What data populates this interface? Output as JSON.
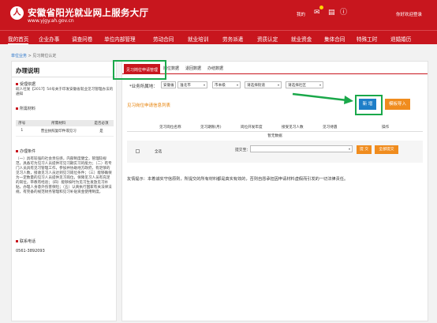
{
  "header": {
    "logo_glyph": "人",
    "title": "安徽省阳光就业网上服务大厅",
    "url": "www.yjgy.ah.gov.cn",
    "links": {
      "home": "我的",
      "welcome": "你好欢迎登录"
    },
    "icons": [
      "mail-icon",
      "doc-icon",
      "info-icon"
    ]
  },
  "nav": {
    "items": [
      "我的首页",
      "企业办事",
      "调查问卷",
      "单位内部管理",
      "劳动合同",
      "就业培训",
      "劳务派遣",
      "资质认定",
      "就业资金",
      "集体合同",
      "特殊工时",
      "退婚婚历"
    ],
    "active_index": 0
  },
  "breadcrumb": {
    "home": "单位业务",
    "sep": ">",
    "current": "见习岗位认定"
  },
  "left": {
    "title": "办理说明",
    "basis_title": "受理依据",
    "basis_text": "皖人社发【2017】54号关于印发安徽省就业见习管理办法的通知",
    "materials_title": "所需材料",
    "table_headers": [
      "序号",
      "所需材料",
      "是否必须"
    ],
    "table_rows": [
      {
        "no": "1",
        "name": "营业执照复印件或见习",
        "required": "是"
      }
    ],
    "conditions_title": "办理条件",
    "conditions_text": "（一）具有较强的社会责任感，内部制度健全，管理较规范，具备可为见习人员提供可见习期实习的能力；（二）有专门人员具有见习管理工作，参加并协助地方政府，有足够的见习人数，接收见习人员达到见习岗位条件；（三）能够确保为一定数量的见习人员提供见习岗位，保障见习人员有充足的岗位，带教有经验；（四）能够按时为见习生发放见习补贴，办理人身意外伤害保险；（五）认真执行国家有关法律法规，有完备的规范财务管理和见习补贴资金使用制度。",
    "contact_title": "联系电话",
    "phone": "0561-3892093"
  },
  "main": {
    "tabs": [
      "见习岗位申请管理",
      "岗位数据",
      "退回数据",
      "办结数据"
    ],
    "active_tab": 0,
    "filter_label": "*业务所属地：",
    "filters": [
      "安徽省",
      "淮北市",
      "市本级",
      "请选择街道",
      "请选择社区"
    ],
    "list_title": "见习岗位申请信息列表",
    "add_button": "新 增",
    "import_button": "模板导入",
    "columns": [
      "见习岗位名称",
      "见习期限(月)",
      "岗位开发年度",
      "接受见习人数",
      "见习待遇",
      "操作"
    ],
    "empty_text": "暂无数据",
    "select_all": "全选",
    "bulk_label": "提交至：",
    "submit_button": "提 交",
    "submit_all_button": "全部提交",
    "tip": "友情提示：本着诚实守信原则，所提交的所有材料都是真实有效的，否则自愿承担因申请材料虚假而引发的一切法律责任。"
  },
  "colors": {
    "brand": "#c8161e",
    "highlight": "#1aa84a",
    "primary_btn": "#1e7ec8",
    "orange_btn": "#f08c1e"
  }
}
